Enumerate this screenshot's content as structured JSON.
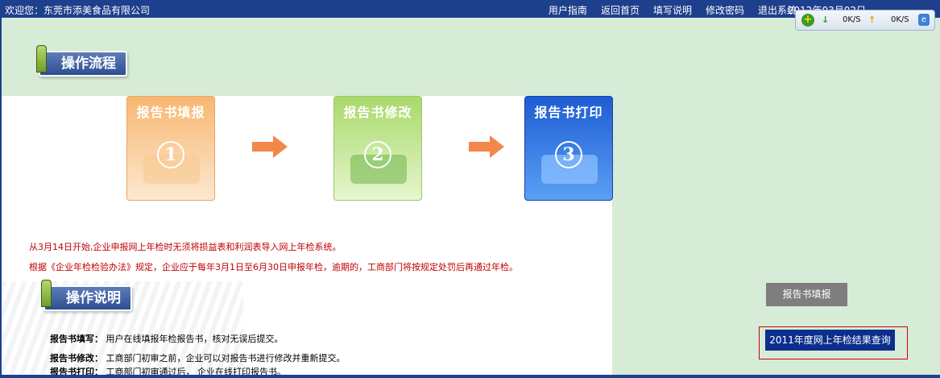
{
  "header": {
    "welcome": "欢迎您：东莞市添美食品有限公司",
    "nav": [
      "用户指南",
      "返回首页",
      "填写说明",
      "修改密码",
      "退出系统"
    ],
    "date": "2012年03月02日"
  },
  "speed_widget": {
    "plus_icon": "+",
    "down_icon": "↓",
    "down_speed": "0K/S",
    "up_icon": "↑",
    "up_speed": "0K/S",
    "ie_icon": "e"
  },
  "process": {
    "title": "操作流程",
    "steps": [
      {
        "label": "报告书填报",
        "number": "1",
        "color": "#f9c07a"
      },
      {
        "label": "报告书修改",
        "number": "2",
        "color": "#b5e07a"
      },
      {
        "label": "报告书打印",
        "number": "3",
        "color": "#2f74de"
      }
    ]
  },
  "notices": [
    "从3月14日开始,企业申报网上年检时无须将损益表和利润表导入网上年检系统。",
    "根据《企业年检检验办法》规定，企业应于每年3月1日至6月30日申报年检，逾期的，工商部门将按规定处罚后再通过年检。"
  ],
  "instructions": {
    "title": "操作说明",
    "items": [
      {
        "term": "报告书填写：",
        "text": "用户在线填报年检报告书，核对无误后提交。"
      },
      {
        "term": "报告书修改：",
        "text": "工商部门初审之前，企业可以对报告书进行修改并重新提交。"
      },
      {
        "term": "报告书打印：",
        "text": "工商部门初审通过后，  企业在线打印报告书。"
      }
    ]
  },
  "side_buttons": {
    "fill_report": "报告书填报",
    "result_query": "2011年度网上年检结果查询"
  }
}
